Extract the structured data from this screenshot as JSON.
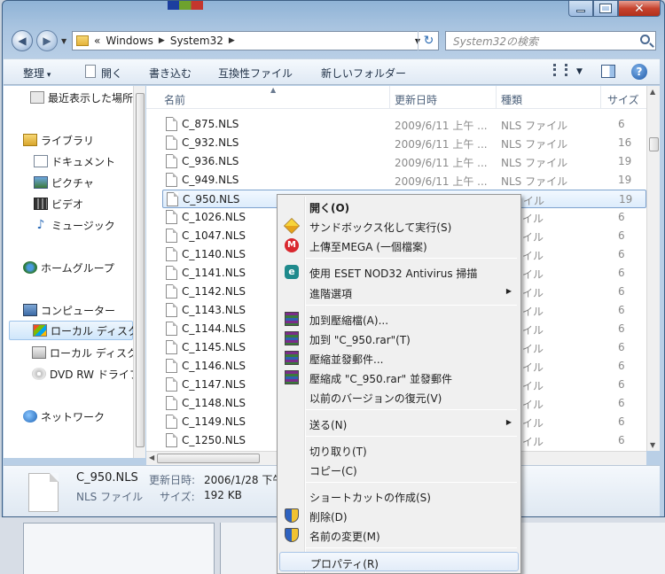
{
  "window": {
    "address": {
      "overflow": "«",
      "crumbs": [
        "Windows",
        "System32"
      ]
    },
    "search_placeholder": "System32の検索"
  },
  "toolbar": {
    "organize": "整理",
    "open": "開く",
    "write": "書き込む",
    "compat": "互換性ファイル",
    "new_folder": "新しいフォルダー"
  },
  "nav": {
    "items": [
      {
        "label": "最近表示した場所",
        "icon": "recent-places-icon"
      },
      {
        "label": "ライブラリ",
        "icon": "library-icon"
      },
      {
        "label": "ドキュメント",
        "icon": "documents-icon"
      },
      {
        "label": "ピクチャ",
        "icon": "pictures-icon"
      },
      {
        "label": "ビデオ",
        "icon": "videos-icon"
      },
      {
        "label": "ミュージック",
        "icon": "music-icon"
      },
      {
        "label": "ホームグループ",
        "icon": "homegroup-icon"
      },
      {
        "label": "コンピューター",
        "icon": "computer-icon"
      },
      {
        "label": "ローカル ディスク",
        "icon": "local-disk-icon"
      },
      {
        "label": "ローカル ディスク",
        "icon": "local-disk-icon"
      },
      {
        "label": "DVD RW ドライブ",
        "icon": "dvd-drive-icon"
      },
      {
        "label": "ネットワーク",
        "icon": "network-icon"
      }
    ]
  },
  "columns": {
    "name": "名前",
    "date": "更新日時",
    "type": "種類",
    "size": "サイズ"
  },
  "files": [
    {
      "name": "C_875.NLS",
      "date": "2009/6/11 上午 ...",
      "type": "NLS ファイル",
      "size": "6"
    },
    {
      "name": "C_932.NLS",
      "date": "2009/6/11 上午 ...",
      "type": "NLS ファイル",
      "size": "16"
    },
    {
      "name": "C_936.NLS",
      "date": "2009/6/11 上午 ...",
      "type": "NLS ファイル",
      "size": "19"
    },
    {
      "name": "C_949.NLS",
      "date": "2009/6/11 上午 ...",
      "type": "NLS ファイル",
      "size": "19"
    },
    {
      "name": "C_950.NLS",
      "date": "",
      "type": "ファイル",
      "size": "19"
    },
    {
      "name": "C_1026.NLS",
      "date": "",
      "type": "ファイル",
      "size": "6"
    },
    {
      "name": "C_1047.NLS",
      "date": "",
      "type": "ファイル",
      "size": "6"
    },
    {
      "name": "C_1140.NLS",
      "date": "",
      "type": "ファイル",
      "size": "6"
    },
    {
      "name": "C_1141.NLS",
      "date": "",
      "type": "ファイル",
      "size": "6"
    },
    {
      "name": "C_1142.NLS",
      "date": "",
      "type": "ファイル",
      "size": "6"
    },
    {
      "name": "C_1143.NLS",
      "date": "",
      "type": "ファイル",
      "size": "6"
    },
    {
      "name": "C_1144.NLS",
      "date": "",
      "type": "ファイル",
      "size": "6"
    },
    {
      "name": "C_1145.NLS",
      "date": "",
      "type": "ファイル",
      "size": "6"
    },
    {
      "name": "C_1146.NLS",
      "date": "",
      "type": "ファイル",
      "size": "6"
    },
    {
      "name": "C_1147.NLS",
      "date": "",
      "type": "ファイル",
      "size": "6"
    },
    {
      "name": "C_1148.NLS",
      "date": "",
      "type": "ファイル",
      "size": "6"
    },
    {
      "name": "C_1149.NLS",
      "date": "",
      "type": "ファイル",
      "size": "6"
    },
    {
      "name": "C_1250.NLS",
      "date": "",
      "type": "ファイル",
      "size": "6"
    }
  ],
  "selected_file": "C_950.NLS",
  "details": {
    "name": "C_950.NLS",
    "modified_label": "更新日時:",
    "modified_value": "2006/1/28 下午",
    "type": "NLS ファイル",
    "size_label": "サイズ:",
    "size_value": "192 KB"
  },
  "context_menu": {
    "items": [
      {
        "label": "開く(O)",
        "bold": true
      },
      {
        "label": "サンドボックス化して実行(S)",
        "icon": "sandbox-icon"
      },
      {
        "label": "上傳至MEGA (一個檔案)",
        "icon": "mega-icon"
      },
      {
        "label": "使用 ESET NOD32 Antivirus 掃描",
        "icon": "eset-icon"
      },
      {
        "label": "進階選項",
        "submenu": true
      },
      {
        "label": "加到壓縮檔(A)...",
        "icon": "winrar-icon"
      },
      {
        "label": "加到 \"C_950.rar\"(T)",
        "icon": "winrar-icon"
      },
      {
        "label": "壓縮並發郵件...",
        "icon": "winrar-icon"
      },
      {
        "label": "壓縮成 \"C_950.rar\" 並發郵件",
        "icon": "winrar-icon"
      },
      {
        "label": "以前のバージョンの復元(V)"
      },
      {
        "label": "送る(N)",
        "submenu": true
      },
      {
        "label": "切り取り(T)"
      },
      {
        "label": "コピー(C)"
      },
      {
        "label": "ショートカットの作成(S)"
      },
      {
        "label": "削除(D)",
        "icon": "uac-shield-icon"
      },
      {
        "label": "名前の変更(M)",
        "icon": "uac-shield-icon"
      },
      {
        "label": "プロパティ(R)",
        "highlighted": true
      }
    ]
  }
}
